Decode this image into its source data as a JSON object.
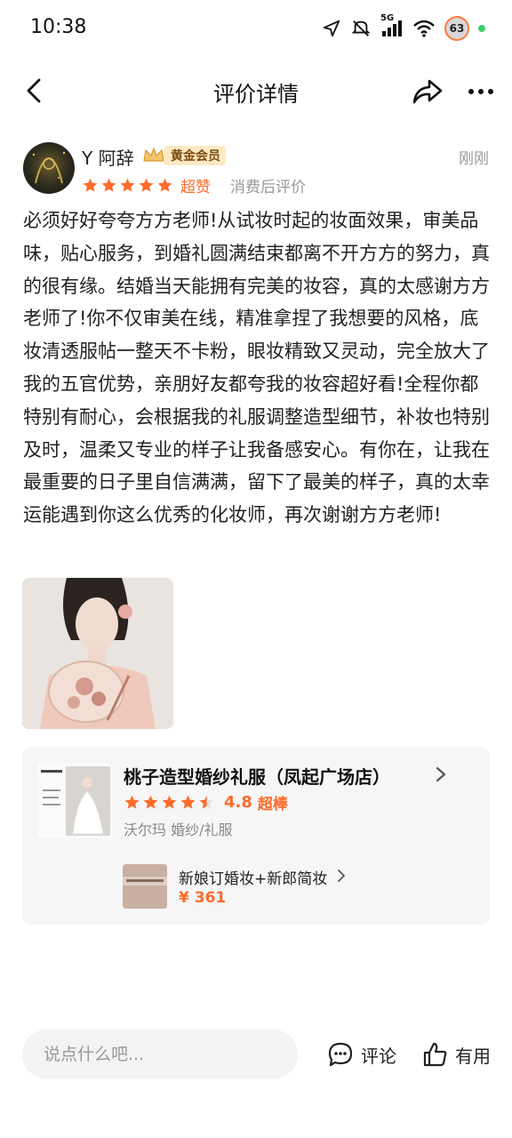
{
  "status_bar": {
    "time": "10:38",
    "network_label": "5G",
    "battery_level": "63"
  },
  "header": {
    "title": "评价详情"
  },
  "review": {
    "user_name": "Y 阿辞",
    "member_badge": "黄金会员",
    "time_ago": "刚刚",
    "stars": 5,
    "rating_word": "超赞",
    "source": "消费后评价",
    "text": "必须好好夸夸方方老师!从试妆时起的妆面效果，审美品味，贴心服务，到婚礼圆满结束都离不开方方的努力，真的很有缘。结婚当天能拥有完美的妆容，真的太感谢方方老师了!你不仅审美在线，精准拿捏了我想要的风格，底妆清透服帖一整天不卡粉，眼妆精致又灵动，完全放大了我的五官优势，亲朋好友都夸我的妆容超好看!全程你都特别有耐心，会根据我的礼服调整造型细节，补妆也特别及时，温柔又专业的样子让我备感安心。有你在，让我在最重要的日子里自信满满，留下了最美的样子，真的太幸运能遇到你这么优秀的化妆师，再次谢谢方方老师!"
  },
  "shop": {
    "name": "桃子造型婚纱礼服（凤起广场店）",
    "rating_score": "4.8",
    "rating_word": "超棒",
    "rating_stars": 4.5,
    "meta": "沃尔玛 婚纱/礼服",
    "product": {
      "name": "新娘订婚妆+新郎简妆",
      "price": "¥ 361"
    }
  },
  "bottom_bar": {
    "comment_placeholder": "说点什么吧...",
    "comment_label": "评论",
    "useful_label": "有用"
  },
  "colors": {
    "accent": "#ff6a2a",
    "badge_bg": "#fde9c2",
    "muted": "#999999"
  },
  "icons": [
    "location-arrow-icon",
    "mute-icon",
    "signal-icon",
    "wifi-icon",
    "battery-icon",
    "back-icon",
    "share-icon",
    "more-icon",
    "star-icon",
    "chevron-right-icon",
    "comment-icon",
    "thumb-up-icon"
  ]
}
